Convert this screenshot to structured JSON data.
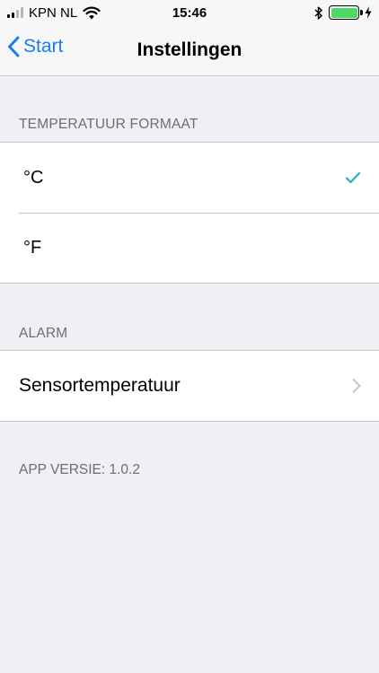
{
  "status_bar": {
    "carrier": "KPN NL",
    "time": "15:46",
    "signal_bars": 4,
    "signal_active": 2,
    "battery_level": 1.0
  },
  "nav": {
    "back_label": "Start",
    "title": "Instellingen"
  },
  "temperature": {
    "header": "TEMPERATUUR FORMAAT",
    "options": [
      {
        "label": "°C",
        "selected": true
      },
      {
        "label": "°F",
        "selected": false
      }
    ]
  },
  "alarm": {
    "header": "ALARM",
    "items": [
      {
        "label": "Sensortemperatuur"
      }
    ]
  },
  "footer": {
    "version_text": "APP VERSIE: 1.0.2"
  },
  "colors": {
    "accent": "#1a7cf5",
    "checkmark": "#1fb1c9",
    "background": "#efeff4",
    "secondary_text": "#6d6d72",
    "battery": "#4cd964"
  }
}
